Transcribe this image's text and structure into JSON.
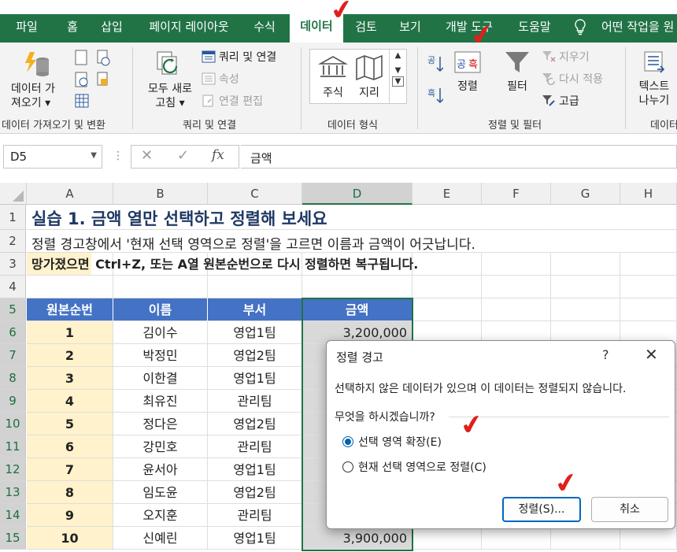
{
  "ribbon_tabs": [
    "파일",
    "홈",
    "삽입",
    "페이지 레이아웃",
    "수식",
    "데이터",
    "검토",
    "보기",
    "개발 도구",
    "도움말",
    "어떤 작업을 원"
  ],
  "active_tab": "데이터",
  "ribbon": {
    "get_data_label_1": "데이터 가",
    "get_data_label_2": "져오기 ▾",
    "group_get_data": "데이터 가져오기 및 변환",
    "refresh_label_1": "모두 새로",
    "refresh_label_2": "고침 ▾",
    "queries_connections": "쿼리 및 연결",
    "properties": "속성",
    "edit_links": "연결 편집",
    "group_queries": "쿼리 및 연결",
    "stocks": "주식",
    "geography": "지리",
    "group_data_types": "데이터 형식",
    "sort_label": "정렬",
    "filter_label": "필터",
    "clear": "지우기",
    "reapply": "다시 적용",
    "advanced": "고급",
    "group_sort_filter": "정렬 및 필터",
    "text_to_columns_1": "텍스트",
    "text_to_columns_2": "나누기",
    "group_data_tools": "데이터"
  },
  "formula_bar": {
    "name_box": "D5",
    "fx": "fx",
    "content": "금액"
  },
  "columns": [
    "A",
    "B",
    "C",
    "D",
    "E",
    "F",
    "G",
    "H"
  ],
  "rows": [
    "1",
    "2",
    "3",
    "4",
    "5",
    "6",
    "7",
    "8",
    "9",
    "10",
    "11",
    "12",
    "13",
    "14",
    "15"
  ],
  "sheet": {
    "title": "실습 1. 금액 열만 선택하고 정렬해 보세요",
    "line2": "정렬 경고창에서 '현재 선택 영역으로 정렬'을 고르면 이름과 금액이 어긋납니다.",
    "line3_highlight": "망가졌으면",
    "line3_rest": " Ctrl+Z, 또는 A열 원본순번으로 다시 정렬하면 복구됩니다.",
    "table_headers": [
      "원본순번",
      "이름",
      "부서",
      "금액"
    ],
    "table_rows": [
      [
        "1",
        "김이수",
        "영업1팀",
        "3,200,000"
      ],
      [
        "2",
        "박정민",
        "영업2팀",
        ""
      ],
      [
        "3",
        "이한결",
        "영업1팀",
        ""
      ],
      [
        "4",
        "최유진",
        "관리팀",
        ""
      ],
      [
        "5",
        "정다은",
        "영업2팀",
        ""
      ],
      [
        "6",
        "강민호",
        "관리팀",
        ""
      ],
      [
        "7",
        "윤서아",
        "영업1팀",
        ""
      ],
      [
        "8",
        "임도윤",
        "영업2팀",
        ""
      ],
      [
        "9",
        "오지훈",
        "관리팀",
        ""
      ],
      [
        "10",
        "신예린",
        "영업1팀",
        "3,900,000"
      ]
    ]
  },
  "dialog": {
    "title": "정렬 경고",
    "help": "?",
    "close": "✕",
    "message": "선택하지 않은 데이터가 있으며 이 데이터는 정렬되지 않습니다.",
    "question": "무엇을 하시겠습니까?",
    "option_expand": "선택 영역 확장(E)",
    "option_current": "현재 선택 영역으로 정렬(C)",
    "selected_option": "expand",
    "sort_button": "정렬(S)...",
    "cancel_button": "취소"
  },
  "annotations": {
    "check": "✔"
  },
  "colors": {
    "excel_green": "#217346",
    "header_blue": "#4472c4",
    "highlight_yellow": "#fff2cc",
    "check_red": "#e0201b"
  }
}
